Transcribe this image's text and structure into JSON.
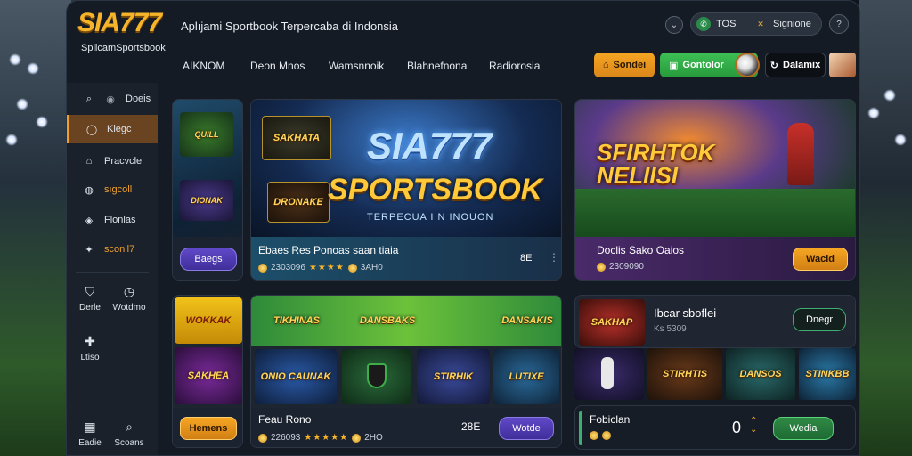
{
  "brand": {
    "logo": "SIA777",
    "logo_sub": "SplicamSportsbook",
    "tagline": "Aplıjami Sportbook Terpercaba di Indonsia"
  },
  "header": {
    "toggle_a": "TOS",
    "toggle_b": "Signione",
    "nav": [
      "AIKNOM",
      "Deon Mnos",
      "Wamsnnoik",
      "Blahnefnona",
      "Radiorosia"
    ],
    "btn_orange": "Sondei",
    "btn_green": "Gontolor",
    "btn_black": "Dalamix"
  },
  "sidebar": {
    "items": [
      {
        "label": "Doeis",
        "icon": "search-icon"
      },
      {
        "label": "Kiegc",
        "icon": "chat-icon"
      },
      {
        "label": "Pracvcle",
        "icon": "home-icon"
      },
      {
        "label": "sıgcoll",
        "icon": "globe-icon"
      },
      {
        "label": "Flonlas",
        "icon": "gamepad-icon"
      },
      {
        "label": "sconll7",
        "icon": "bulb-icon"
      }
    ],
    "small_a": "Derle",
    "small_b": "Wotdmo",
    "small_c": "Ltiso",
    "footer_a": "Eadie",
    "footer_b": "Scoans"
  },
  "cards": {
    "left_small_btn": "Baegs",
    "hero_title": "SIA777",
    "hero_sub": "SPORTSBOOK",
    "hero_tag": "TERPECUA I N INOUON",
    "hero_badge_a": "SAKHATA",
    "hero_badge_b": "DRONAKE",
    "hero_strip_title": "Ebaes Res Ponoas saan tiaia",
    "hero_strip_rating": "2303096",
    "hero_strip_rating_b": "3AH0",
    "hero_strip_right": "8E",
    "right_hero_title": "SFIRHTOK NELIISI",
    "right_strip_title": "Doclis Sako Oaios",
    "right_strip_rating": "2309090",
    "right_strip_btn": "Wacid",
    "tile_left_a": "WOKKAK",
    "tile_left_b": "SAKHEA",
    "tile_left_btn": "Hemens",
    "mid_row1": [
      "TIKHINAS",
      "DANSBAKS",
      "DANSAKIS"
    ],
    "mid_row2": [
      "ONIO CAUNAK",
      "",
      "STIRHIK",
      "LUTIXE"
    ],
    "mid_strip_title": "Feau Rono",
    "mid_strip_rating": "226093",
    "mid_strip_rating_b": "2HO",
    "mid_strip_num": "28E",
    "mid_strip_btn": "Wotde",
    "right_mid_title": "Ibcar sboflei",
    "right_mid_sub": "Ks 5309",
    "right_mid_btn": "Dnegr",
    "right_mid_badge": "SAKHAP",
    "right_tiles": [
      "",
      "STIRHTIS",
      "DANSOS",
      "STINKBB"
    ],
    "right_bottom_title": "Fobiclan",
    "right_bottom_num": "0",
    "right_bottom_btn": "Wedia"
  },
  "colors": {
    "accent_orange": "#f6a623",
    "accent_green": "#3fbf55",
    "accent_purple": "#6049c8",
    "panel": "#151b24"
  }
}
